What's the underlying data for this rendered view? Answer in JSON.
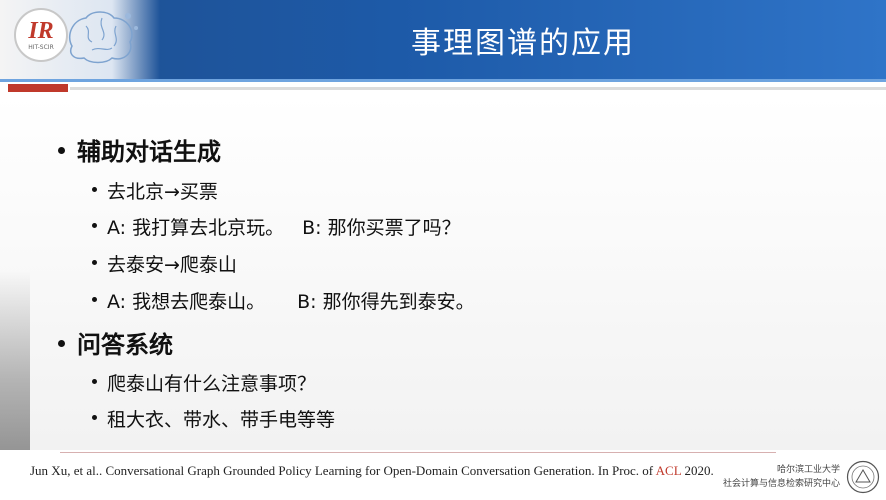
{
  "header": {
    "title": "事理图谱的应用",
    "logo_text": "IR",
    "logo_sub": "HIT-SCIR"
  },
  "sections": [
    {
      "label": "辅助对话生成",
      "items": [
        {
          "text": "去北京→买票"
        },
        {
          "a": "A: 我打算去北京玩。",
          "b": "B: 那你买票了吗？"
        },
        {
          "text": "去泰安→爬泰山"
        },
        {
          "a": "A: 我想去爬泰山。",
          "b": "B: 那你得先到泰安。"
        }
      ]
    },
    {
      "label": "问答系统",
      "items": [
        {
          "text": "爬泰山有什么注意事项？"
        },
        {
          "text": "租大衣、带水、带手电等等"
        }
      ]
    }
  ],
  "footer": {
    "citation_pre": "Jun Xu, et al.. Conversational Graph Grounded Policy Learning for Open-Domain Conversation Generation. In Proc. of ",
    "citation_venue": "ACL",
    "citation_post": " 2020.",
    "inst_line1": "哈尔滨工业大学",
    "inst_line2": "社会计算与信息检索研究中心"
  },
  "colors": {
    "header_blue": "#1d5aa8",
    "accent_red": "#c0392b"
  }
}
